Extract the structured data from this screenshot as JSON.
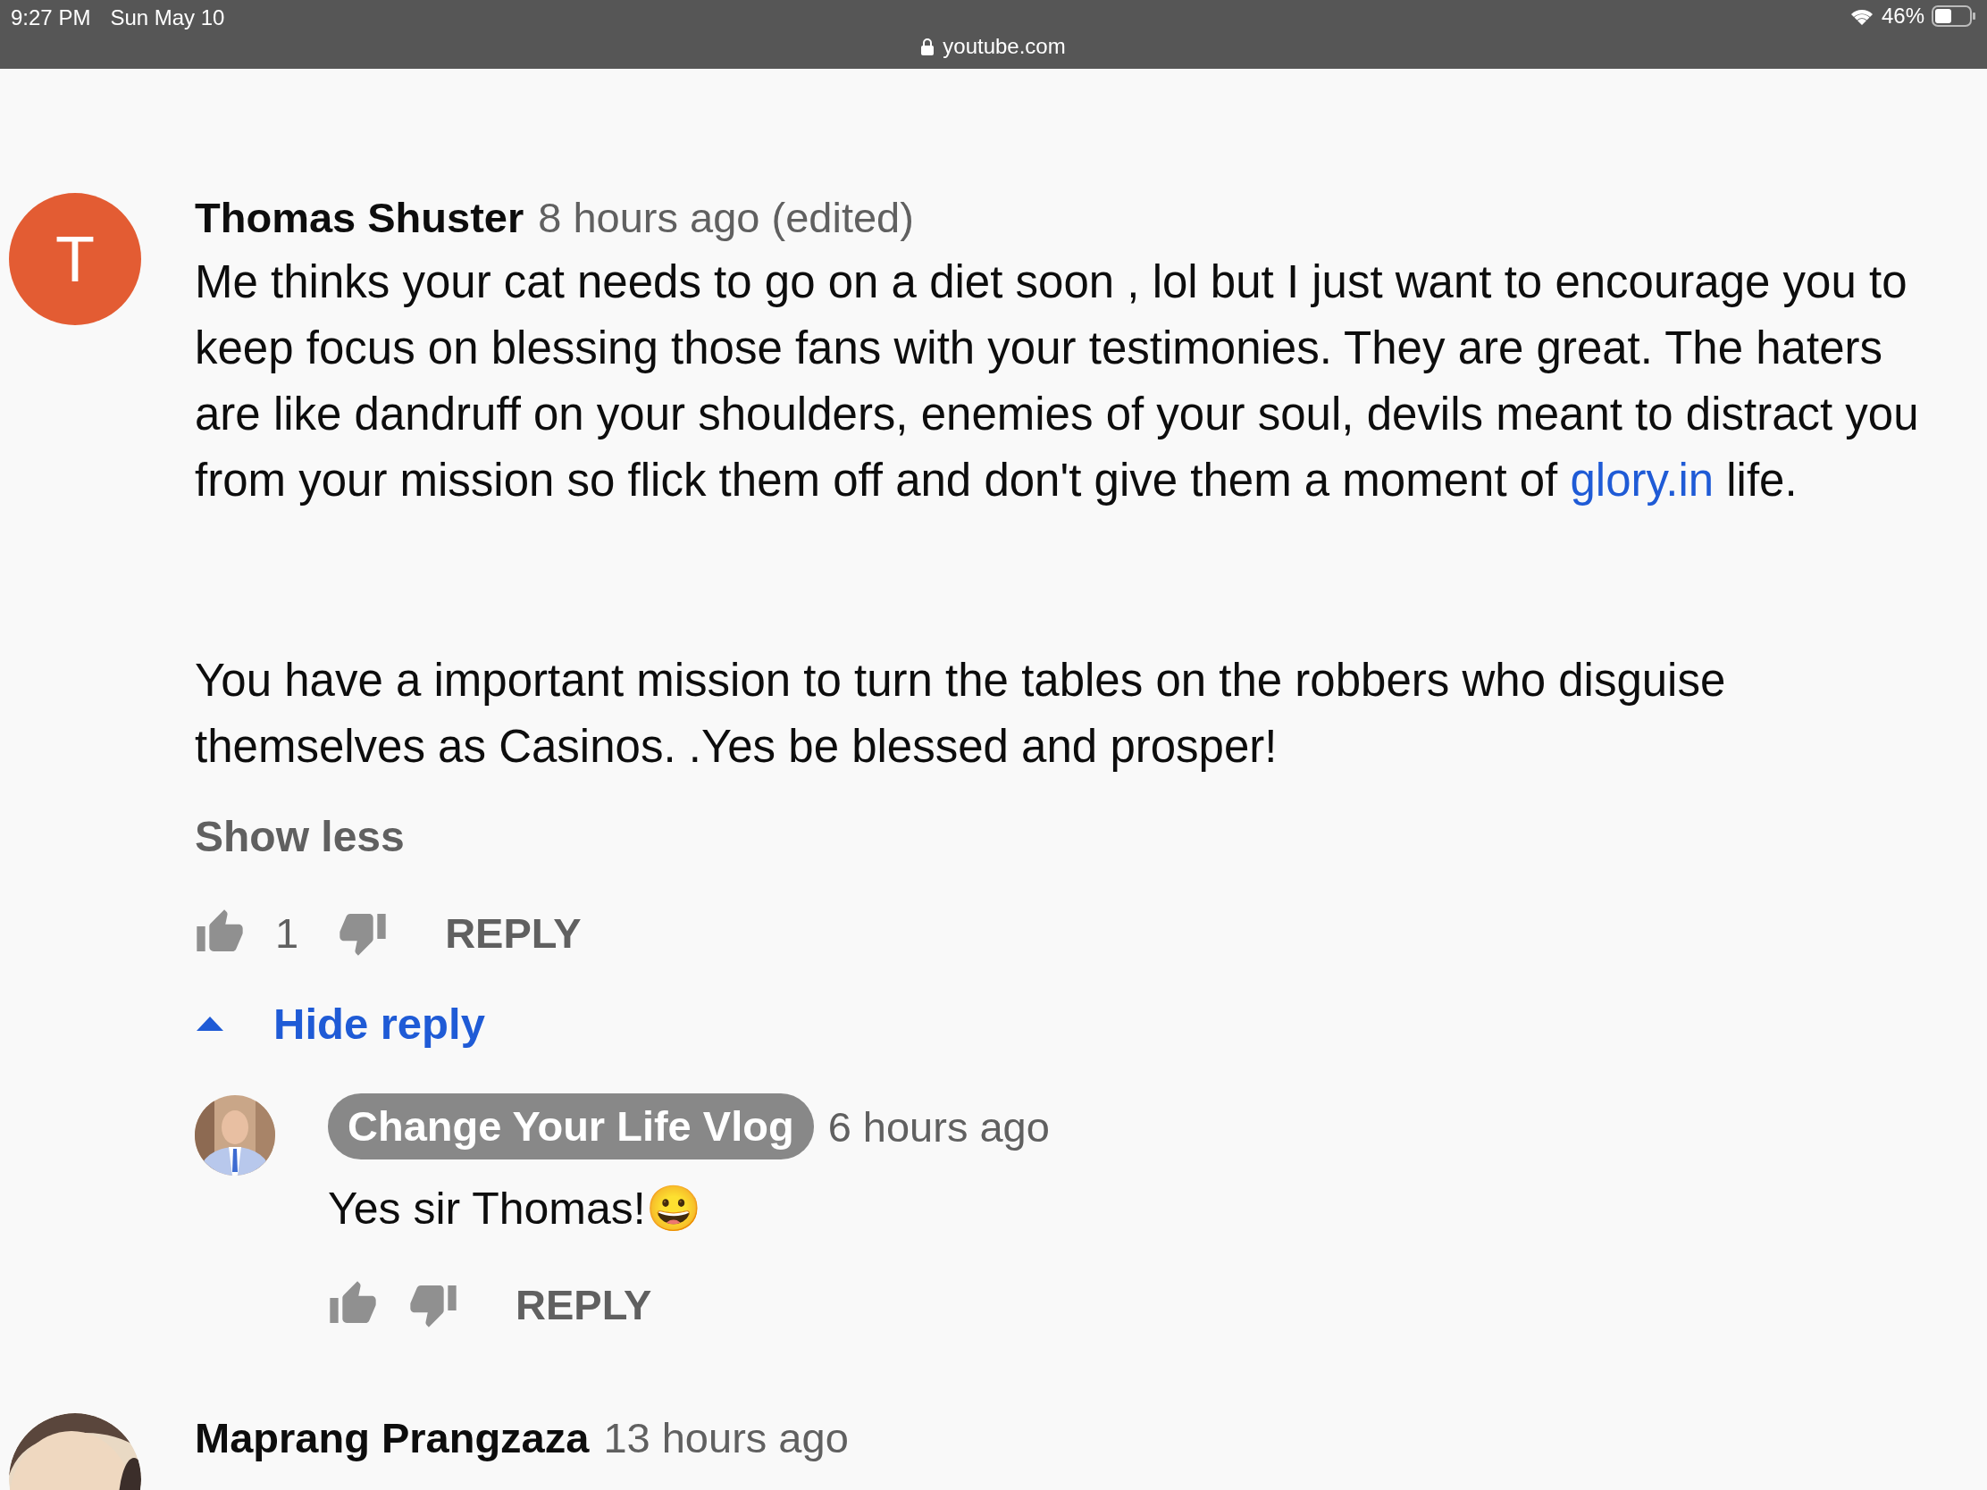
{
  "status_bar": {
    "time": "9:27 PM",
    "date": "Sun May 10",
    "url": "youtube.com",
    "battery": "46%"
  },
  "comments": [
    {
      "author": "Thomas Shuster",
      "time": "8 hours ago (edited)",
      "avatar": {
        "kind": "letter",
        "letter": "T",
        "color": "#e35c33"
      },
      "paragraphs": [
        [
          {
            "kind": "text",
            "text": "Me thinks your cat needs to go on a diet soon , lol but I just want to encourage you to keep focus on blessing those fans with your testimonies. They are great.  The haters are like dandruff on your shoulders, enemies of your soul, devils meant to distract you from your mission so flick them off and don't give them a moment of "
          },
          {
            "kind": "link",
            "text": "glory.in"
          },
          {
            "kind": "text",
            "text": " life."
          }
        ],
        [
          {
            "kind": "text",
            "text": "You have a important mission to turn the tables on the robbers who disguise themselves as Casinos. .Yes be blessed and prosper!"
          }
        ]
      ],
      "show_less": "Show less",
      "likes": "1",
      "reply_label": "REPLY",
      "replies_toggle": {
        "label": "Hide reply",
        "expanded": true
      },
      "replies": [
        {
          "author": "Change Your Life Vlog",
          "author_highlight": true,
          "time": "6 hours ago",
          "text": "Yes sir Thomas!😀",
          "reply_label": "REPLY"
        }
      ]
    },
    {
      "author": "Maprang Prangzaza",
      "time": "13 hours ago"
    }
  ]
}
